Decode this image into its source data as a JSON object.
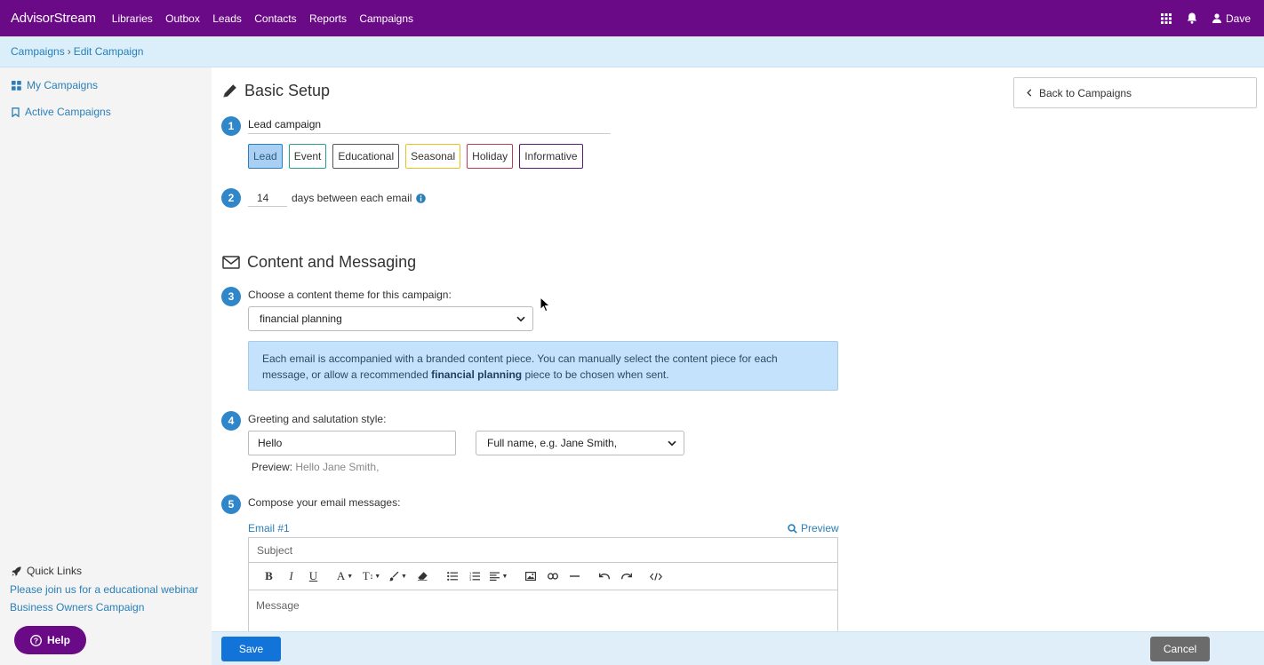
{
  "app": {
    "brand": "AdvisorStream"
  },
  "nav": {
    "items": [
      "Libraries",
      "Outbox",
      "Leads",
      "Contacts",
      "Reports",
      "Campaigns"
    ],
    "user": "Dave"
  },
  "breadcrumb": {
    "parent": "Campaigns",
    "separator": "›",
    "current": "Edit Campaign"
  },
  "sidebar": {
    "items": [
      {
        "label": "My Campaigns",
        "icon": "grid-icon"
      },
      {
        "label": "Active Campaigns",
        "icon": "bookmark-icon"
      }
    ],
    "quick_links_title": "Quick Links",
    "quick_links": [
      "Please join us for a educational webinar",
      "Business Owners Campaign"
    ],
    "help_label": "Help"
  },
  "basic_setup": {
    "title": "Basic Setup",
    "step1": "1",
    "campaign_name": "Lead campaign",
    "types": [
      {
        "label": "Lead",
        "color": "#2a7fb8",
        "selected": true
      },
      {
        "label": "Event",
        "color": "#2a9d8f",
        "selected": false
      },
      {
        "label": "Educational",
        "color": "#555555",
        "selected": false
      },
      {
        "label": "Seasonal",
        "color": "#e6c229",
        "selected": false
      },
      {
        "label": "Holiday",
        "color": "#c0395a",
        "selected": false
      },
      {
        "label": "Informative",
        "color": "#5a1a6e",
        "selected": false
      }
    ],
    "step2": "2",
    "days_value": "14",
    "days_label": "days between each email"
  },
  "content": {
    "title": "Content and Messaging",
    "step3": "3",
    "theme_label": "Choose a content theme for this campaign:",
    "theme_value": "financial planning",
    "info_part1": "Each email is accompanied with a branded content piece. You can manually select the content piece for each message, or allow a recommended",
    "info_bold": "financial planning",
    "info_part2": "piece to be chosen when sent.",
    "step4": "4",
    "greeting_label": "Greeting and salutation style:",
    "greeting_value": "Hello",
    "salutation_value": "Full name, e.g. Jane Smith,",
    "preview_label": "Preview:",
    "preview_value": "Hello Jane Smith,",
    "step5": "5",
    "compose_label": "Compose your email messages:",
    "email_label": "Email #1",
    "preview_link": "Preview",
    "subject_placeholder": "Subject",
    "message_placeholder": "Message"
  },
  "actions": {
    "back": "Back to Campaigns",
    "save": "Save",
    "cancel": "Cancel"
  },
  "colors": {
    "brand": "#6b0a86",
    "step": "#2f86c9",
    "save": "#1273d8",
    "cancel": "#6b6b6b"
  }
}
